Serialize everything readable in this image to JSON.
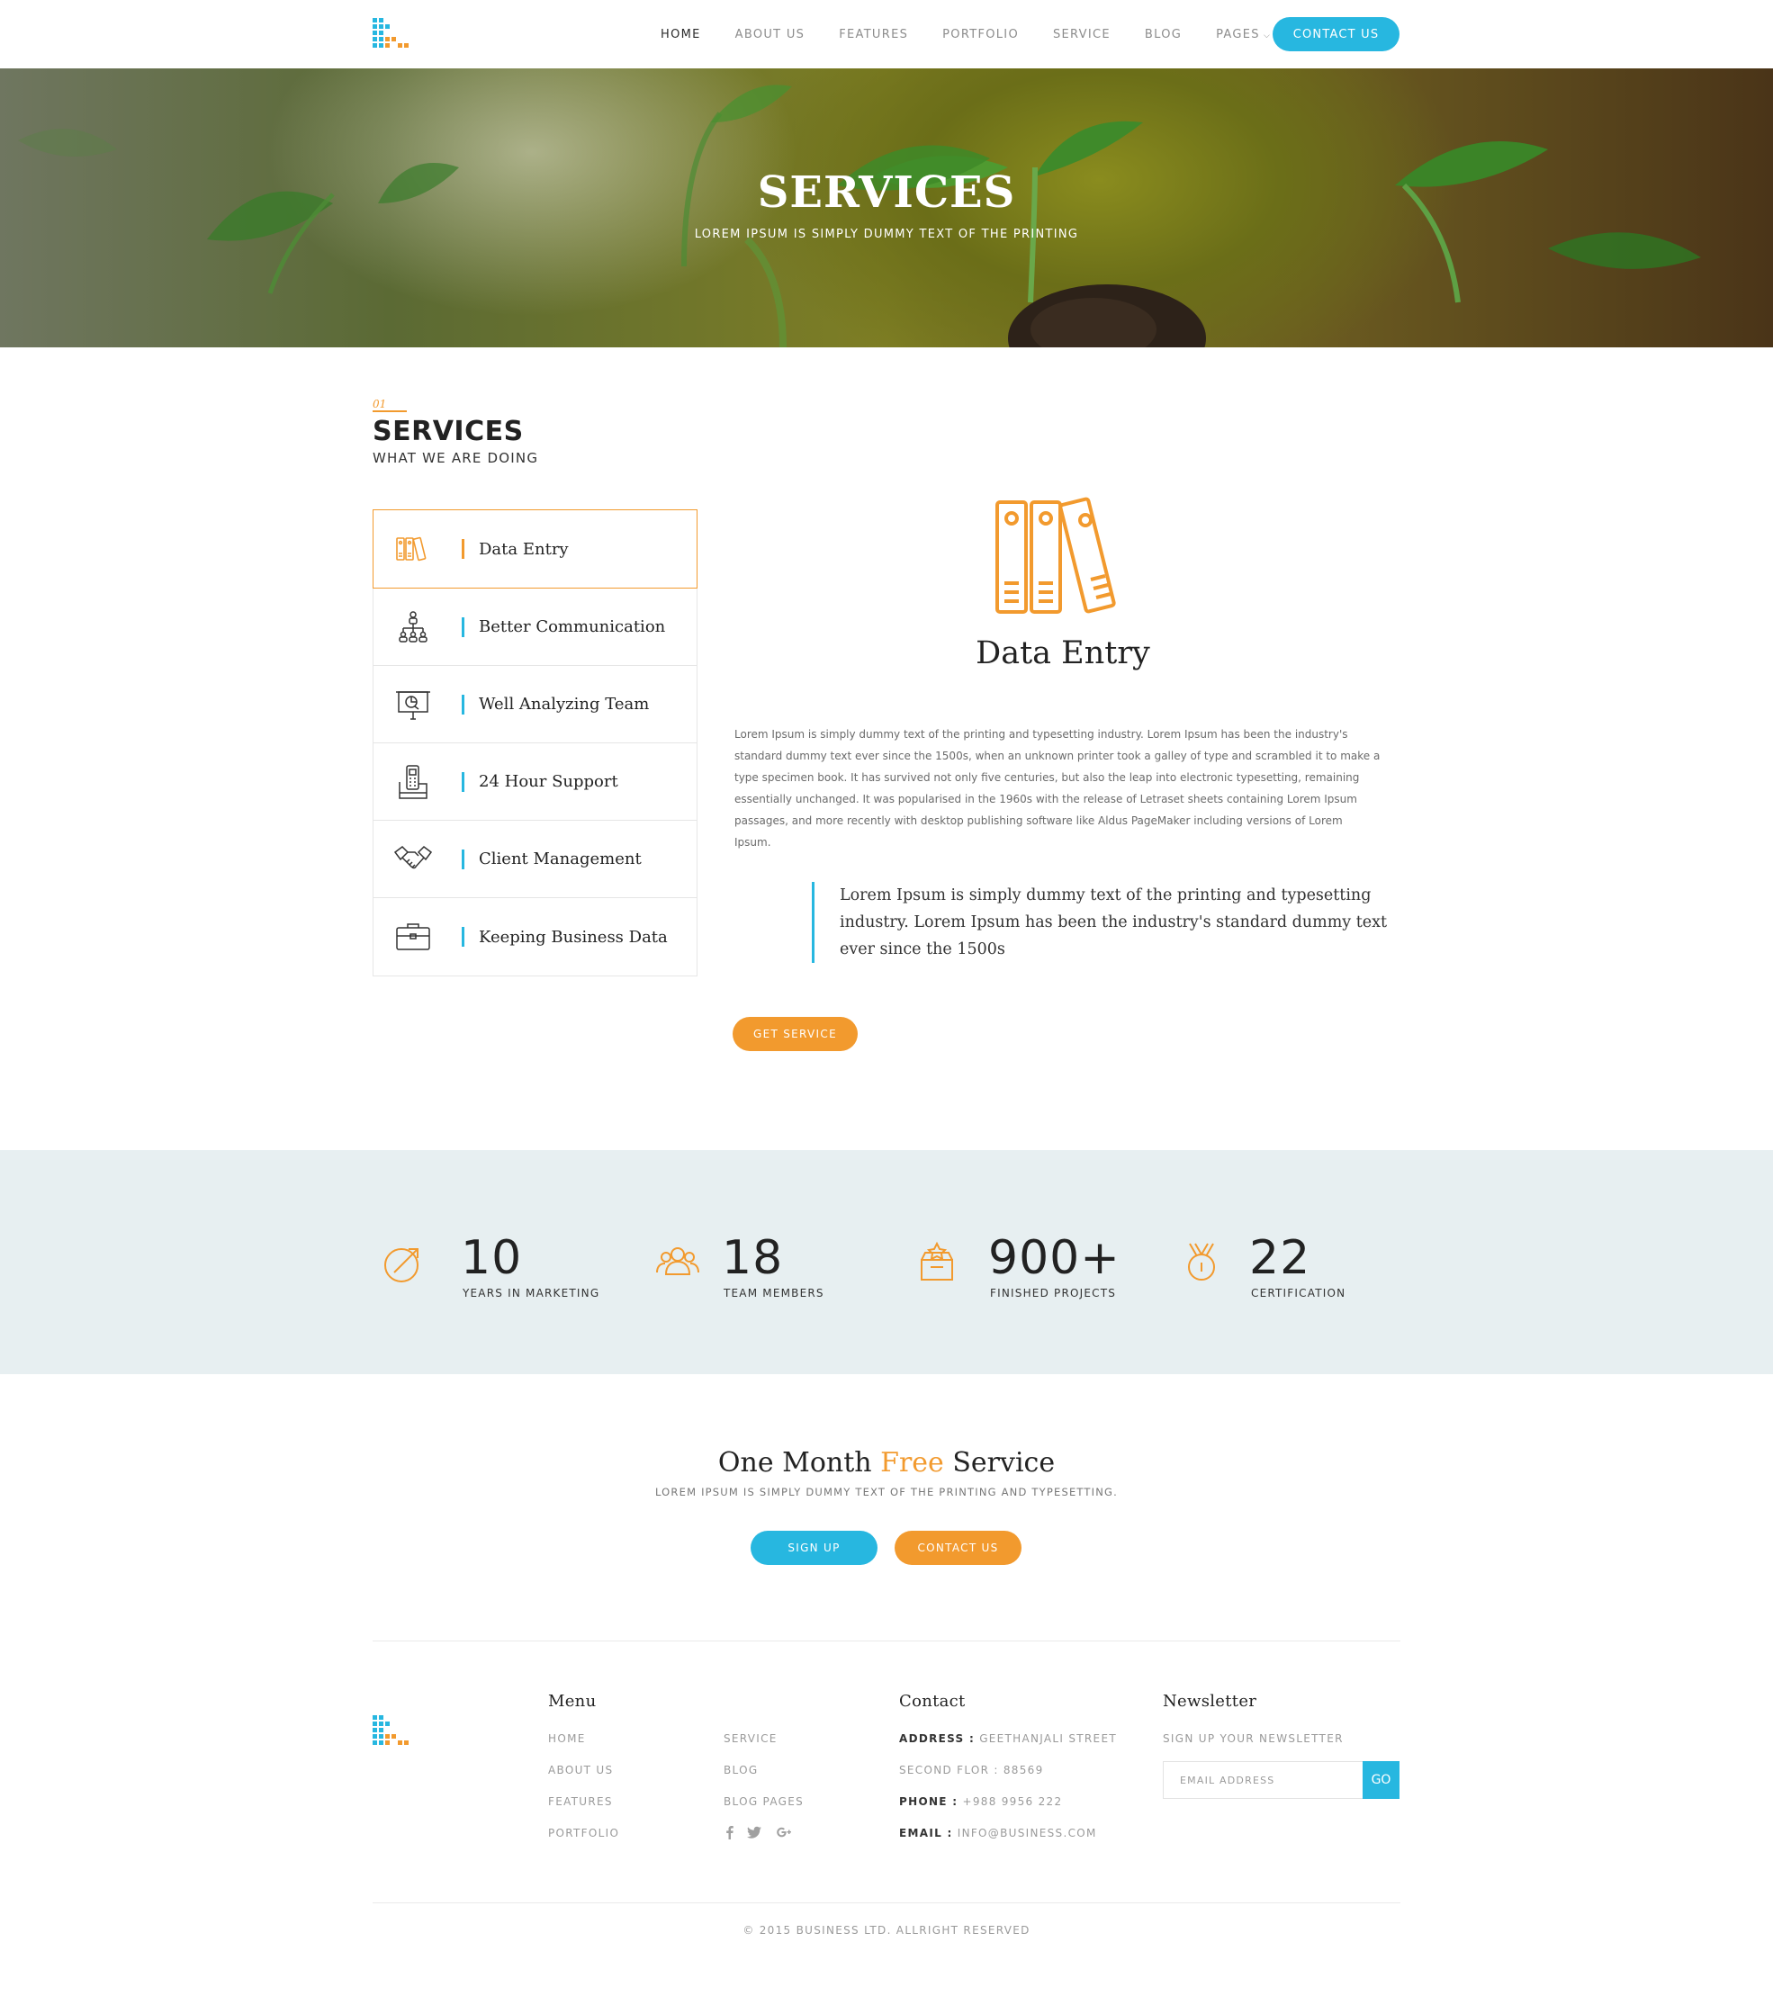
{
  "nav": {
    "items": [
      {
        "label": "HOME",
        "active": true
      },
      {
        "label": "ABOUT US",
        "active": false
      },
      {
        "label": "FEATURES",
        "active": false
      },
      {
        "label": "PORTFOLIO",
        "active": false
      },
      {
        "label": "SERVICE",
        "active": false
      },
      {
        "label": "BLOG",
        "active": false
      },
      {
        "label": "PAGES",
        "active": false
      }
    ],
    "cta": "CONTACT US",
    "logo_icon": "bar-logo-icon"
  },
  "hero": {
    "title": "SERVICES",
    "subtitle": "LOREM IPSUM IS SIMPLY DUMMY TEXT OF THE PRINTING"
  },
  "section": {
    "number": "01",
    "title": "SERVICES",
    "subtitle": "WHAT WE ARE DOING"
  },
  "services": [
    {
      "label": "Data Entry",
      "icon": "binders-icon",
      "active": true
    },
    {
      "label": "Better Communication",
      "icon": "network-icon",
      "active": false
    },
    {
      "label": "Well Analyzing Team",
      "icon": "presentation-icon",
      "active": false
    },
    {
      "label": "24 Hour Support",
      "icon": "phone-icon",
      "active": false
    },
    {
      "label": "Client Management",
      "icon": "handshake-icon",
      "active": false
    },
    {
      "label": "Keeping Business Data",
      "icon": "briefcase-icon",
      "active": false
    }
  ],
  "detail": {
    "icon": "binders-icon",
    "title": "Data Entry",
    "body_lines": [
      "Lorem Ipsum is simply dummy text of the printing and typesetting industry. Lorem Ipsum has been the industry's",
      "standard dummy text ever since the 1500s, when an unknown printer took a galley of type and scrambled it to make a",
      "type specimen book. It has survived not only five centuries, but also the leap into electronic typesetting, remaining",
      "essentially unchanged. It was popularised in the 1960s with the release of Letraset sheets containing Lorem Ipsum",
      "passages, and more recently with desktop publishing software like Aldus PageMaker including versions of Lorem",
      "Ipsum."
    ],
    "quote_lines": [
      "Lorem Ipsum is simply dummy text of the printing and typesetting",
      "industry. Lorem Ipsum has been the industry's standard dummy text",
      "ever since the 1500s"
    ],
    "button": "GET SERVICE"
  },
  "stats": [
    {
      "value": "10",
      "label": "YEARS IN MARKETING",
      "icon": "growth-arrow-icon"
    },
    {
      "value": "18",
      "label": "TEAM MEMBERS",
      "icon": "team-icon"
    },
    {
      "value": "900+",
      "label": "FINISHED PROJECTS",
      "icon": "project-box-icon"
    },
    {
      "value": "22",
      "label": "CERTIFICATION",
      "icon": "medal-icon"
    }
  ],
  "promo": {
    "title_pre": "One Month ",
    "title_highlight": "Free",
    "title_post": " Service",
    "subtitle": "LOREM IPSUM IS SIMPLY DUMMY TEXT OF THE PRINTING AND TYPESETTING.",
    "signup": "SIGN UP",
    "contact": "CONTACT US"
  },
  "footer": {
    "menu_heading": "Menu",
    "menu_col1": [
      "HOME",
      "ABOUT US",
      "FEATURES",
      "PORTFOLIO"
    ],
    "menu_col2": [
      "SERVICE",
      "BLOG",
      "BLOG PAGES"
    ],
    "social_icons": [
      "facebook-icon",
      "twitter-icon",
      "google-plus-icon"
    ],
    "contact_heading": "Contact",
    "contact": [
      {
        "key": "ADDRESS :",
        "value": " GEETHANJALI STREET"
      },
      {
        "key": "",
        "value": "SECOND FLOR : 88569"
      },
      {
        "key": "PHONE :",
        "value": " +988 9956 222"
      },
      {
        "key": "EMAIL :",
        "value": " INFO@BUSINESS.COM"
      }
    ],
    "newsletter_heading": "Newsletter",
    "newsletter_sub": "SIGN UP YOUR NEWSLETTER",
    "newsletter_placeholder": "EMAIL ADDRESS",
    "newsletter_button": "GO",
    "copyright": "© 2015 BUSINESS LTD. ALLRIGHT RESERVED"
  },
  "colors": {
    "accent_blue": "#27b7e0",
    "accent_orange": "#f29a2e",
    "stats_bg": "#e7eff1"
  }
}
